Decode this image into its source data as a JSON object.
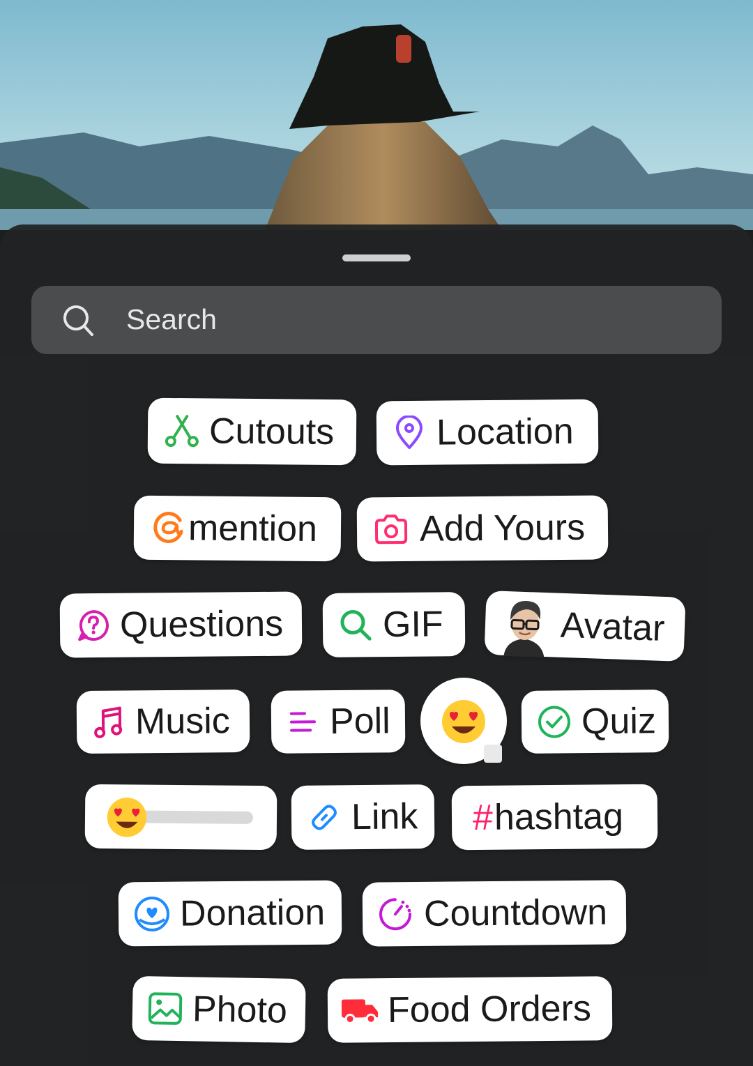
{
  "search": {
    "placeholder": "Search",
    "icon": "search-icon"
  },
  "stickers": {
    "cutouts": {
      "label": "Cutouts",
      "icon": "scissors-icon",
      "color": "#2fb24c"
    },
    "location": {
      "label": "Location",
      "icon": "location-pin-icon",
      "color": "#8a4bff"
    },
    "mention": {
      "label": "mention",
      "icon": "threads-at-icon",
      "color": "#ff7a1a"
    },
    "add_yours": {
      "label": "Add Yours",
      "icon": "camera-icon",
      "color": "#ff2d6f"
    },
    "questions": {
      "label": "Questions",
      "icon": "question-bubble-icon",
      "color": "#d61fae"
    },
    "gif": {
      "label": "GIF",
      "icon": "search-icon",
      "color": "#22b35a"
    },
    "avatar": {
      "label": "Avatar",
      "icon": "avatar-image"
    },
    "music": {
      "label": "Music",
      "icon": "music-note-icon",
      "color": "#e0127a"
    },
    "poll": {
      "label": "Poll",
      "icon": "poll-lines-icon",
      "color": "#c21ad6"
    },
    "emoji": {
      "icon": "heart-eyes-emoji-icon"
    },
    "quiz": {
      "label": "Quiz",
      "icon": "check-circle-icon",
      "color": "#1fb45a"
    },
    "slider": {
      "icon": "heart-eyes-emoji-icon"
    },
    "link": {
      "label": "Link",
      "icon": "link-icon",
      "color": "#1f8bff"
    },
    "hashtag": {
      "prefix": "#",
      "label": "hashtag",
      "icon": "hash-icon",
      "color": "#ff1f6e"
    },
    "donation": {
      "label": "Donation",
      "icon": "heart-coin-icon",
      "color": "#1f8bff"
    },
    "countdown": {
      "label": "Countdown",
      "icon": "countdown-timer-icon",
      "color": "#c21ad6"
    },
    "photo": {
      "label": "Photo",
      "icon": "image-icon",
      "color": "#22b35a"
    },
    "food": {
      "label": "Food Orders",
      "icon": "delivery-truck-icon",
      "color": "#ff2d3a"
    }
  }
}
